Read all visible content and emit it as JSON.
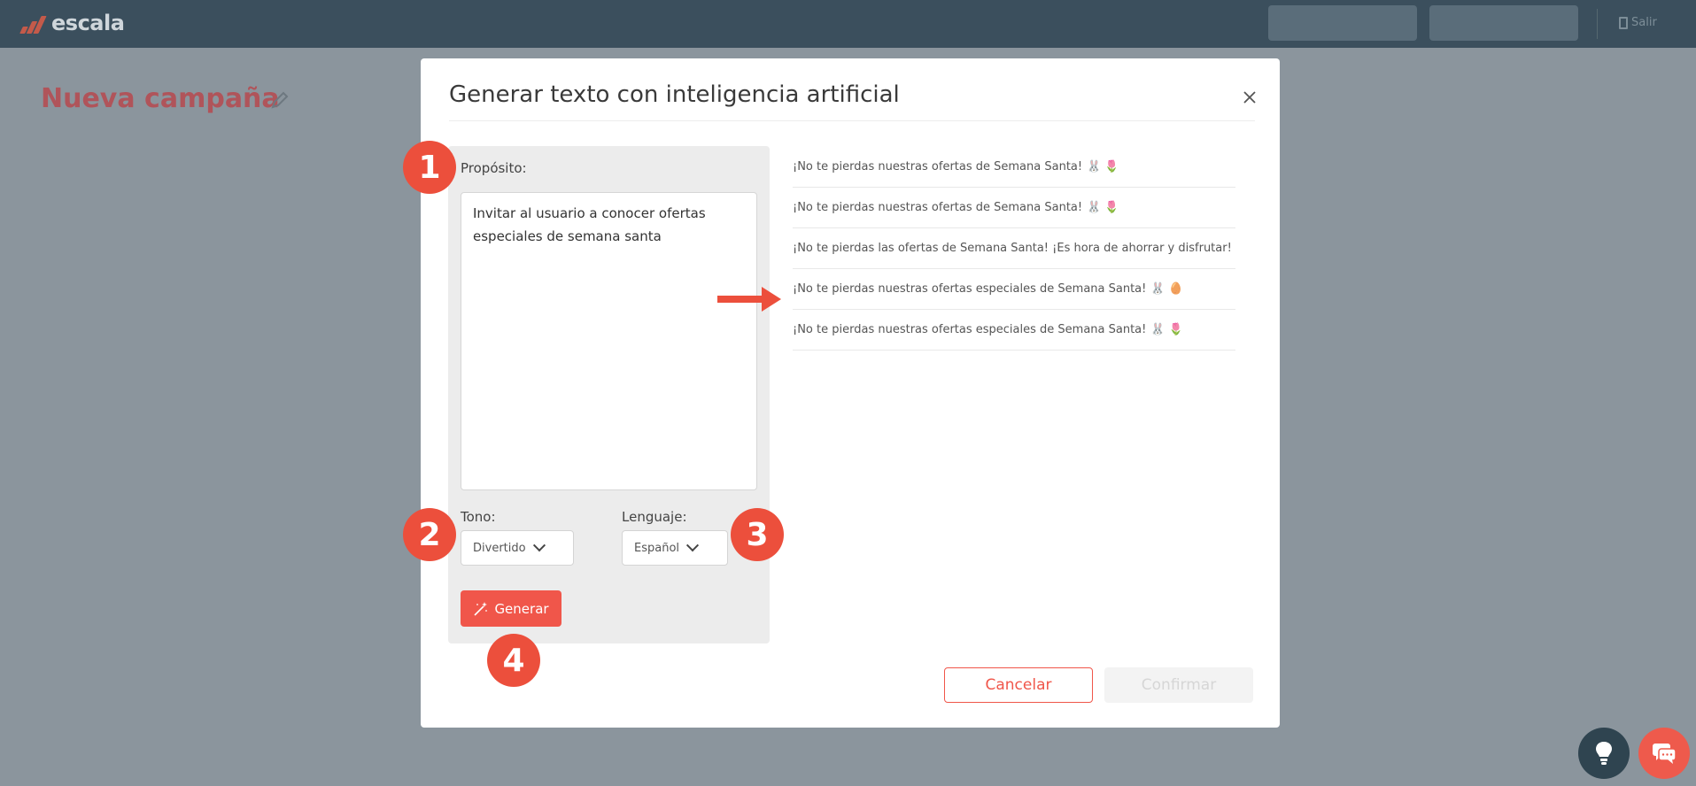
{
  "app": {
    "logo_text": "escala",
    "exit_label": "Salir"
  },
  "page": {
    "title": "Nueva campaña"
  },
  "modal": {
    "title": "Generar texto con inteligencia artificial",
    "purpose_label": "Propósito:",
    "purpose_value": "Invitar al usuario a conocer ofertas especiales de semana santa",
    "tone_label": "Tono:",
    "tone_value": "Divertido",
    "language_label": "Lenguaje:",
    "language_value": "Español",
    "generate_label": "Generar",
    "cancel_label": "Cancelar",
    "confirm_label": "Confirmar",
    "results": [
      {
        "text": "¡No te pierdas nuestras ofertas de Semana Santa!",
        "emoji": "🐰 🌷"
      },
      {
        "text": "¡No te pierdas nuestras ofertas de Semana Santa!",
        "emoji": "🐰 🌷"
      },
      {
        "text": "¡No te pierdas las ofertas de Semana Santa! ¡Es hora de ahorrar y disfrutar!",
        "emoji": ""
      },
      {
        "text": "¡No te pierdas nuestras ofertas especiales de Semana Santa!",
        "emoji": "🐰 🥚"
      },
      {
        "text": "¡No te pierdas nuestras ofertas especiales de Semana Santa!",
        "emoji": "🐰 🌷"
      }
    ]
  },
  "annotations": {
    "m1": "1",
    "m2": "2",
    "m3": "3",
    "m4": "4"
  },
  "colors": {
    "accent": "#f0564a",
    "topbar": "#3b4f5d",
    "overlay": "#8b959d"
  },
  "icons": {
    "close": "close-icon",
    "wand": "magic-wand-icon",
    "chevron": "chevron-down-icon",
    "bulb": "lightbulb-icon",
    "chat": "chat-icon",
    "pencil": "pencil-icon"
  }
}
